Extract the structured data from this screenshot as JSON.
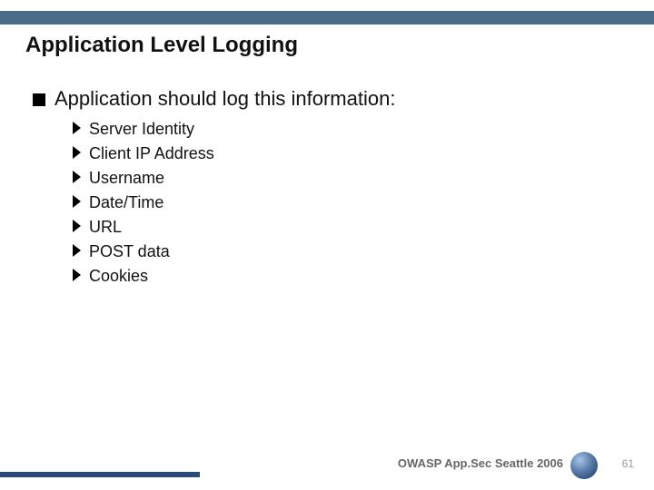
{
  "title": "Application Level Logging",
  "bullet1": "Application should log this information:",
  "items": {
    "i0": "Server Identity",
    "i1": "Client IP Address",
    "i2": "Username",
    "i3": "Date/Time",
    "i4": "URL",
    "i5": "POST data",
    "i6": "Cookies"
  },
  "footer": "OWASP App.Sec Seattle 2006",
  "page": "61"
}
